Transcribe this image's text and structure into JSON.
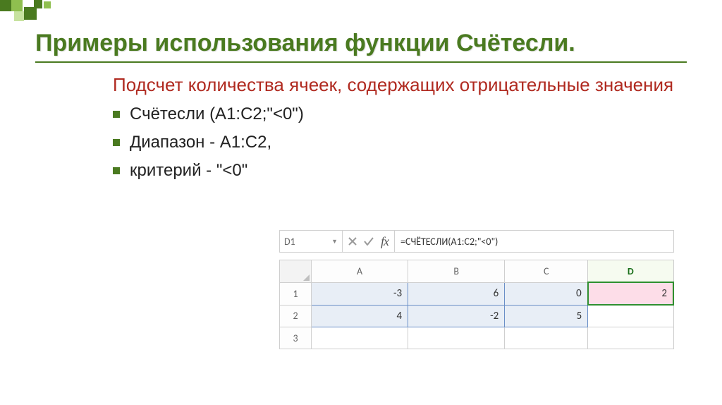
{
  "title": "Примеры использования функции Счётесли.",
  "subtitle": "Подсчет количества ячеек, содержащих отрицательные значения",
  "bullets": [
    "Счётесли (A1:С2;\"<0\")",
    "Диапазон - А1:С2,",
    "критерий - \"<0\""
  ],
  "excel": {
    "namebox": "D1",
    "fx_label": "fx",
    "formula": "=СЧЁТЕСЛИ(A1:C2;\"<0\")",
    "columns": [
      "A",
      "B",
      "C",
      "D"
    ],
    "rows": [
      "1",
      "2",
      "3"
    ]
  },
  "chart_data": {
    "type": "table",
    "columns": [
      "A",
      "B",
      "C",
      "D"
    ],
    "rows": [
      {
        "label": "1",
        "cells": [
          -3,
          6,
          0,
          2
        ]
      },
      {
        "label": "2",
        "cells": [
          4,
          -2,
          5,
          null
        ]
      },
      {
        "label": "3",
        "cells": [
          null,
          null,
          null,
          null
        ]
      }
    ],
    "selected_range": "A1:C2",
    "active_cell": "D1",
    "active_cell_formula": "=СЧЁТЕСЛИ(A1:C2;\"<0\")",
    "active_cell_result": 2
  }
}
